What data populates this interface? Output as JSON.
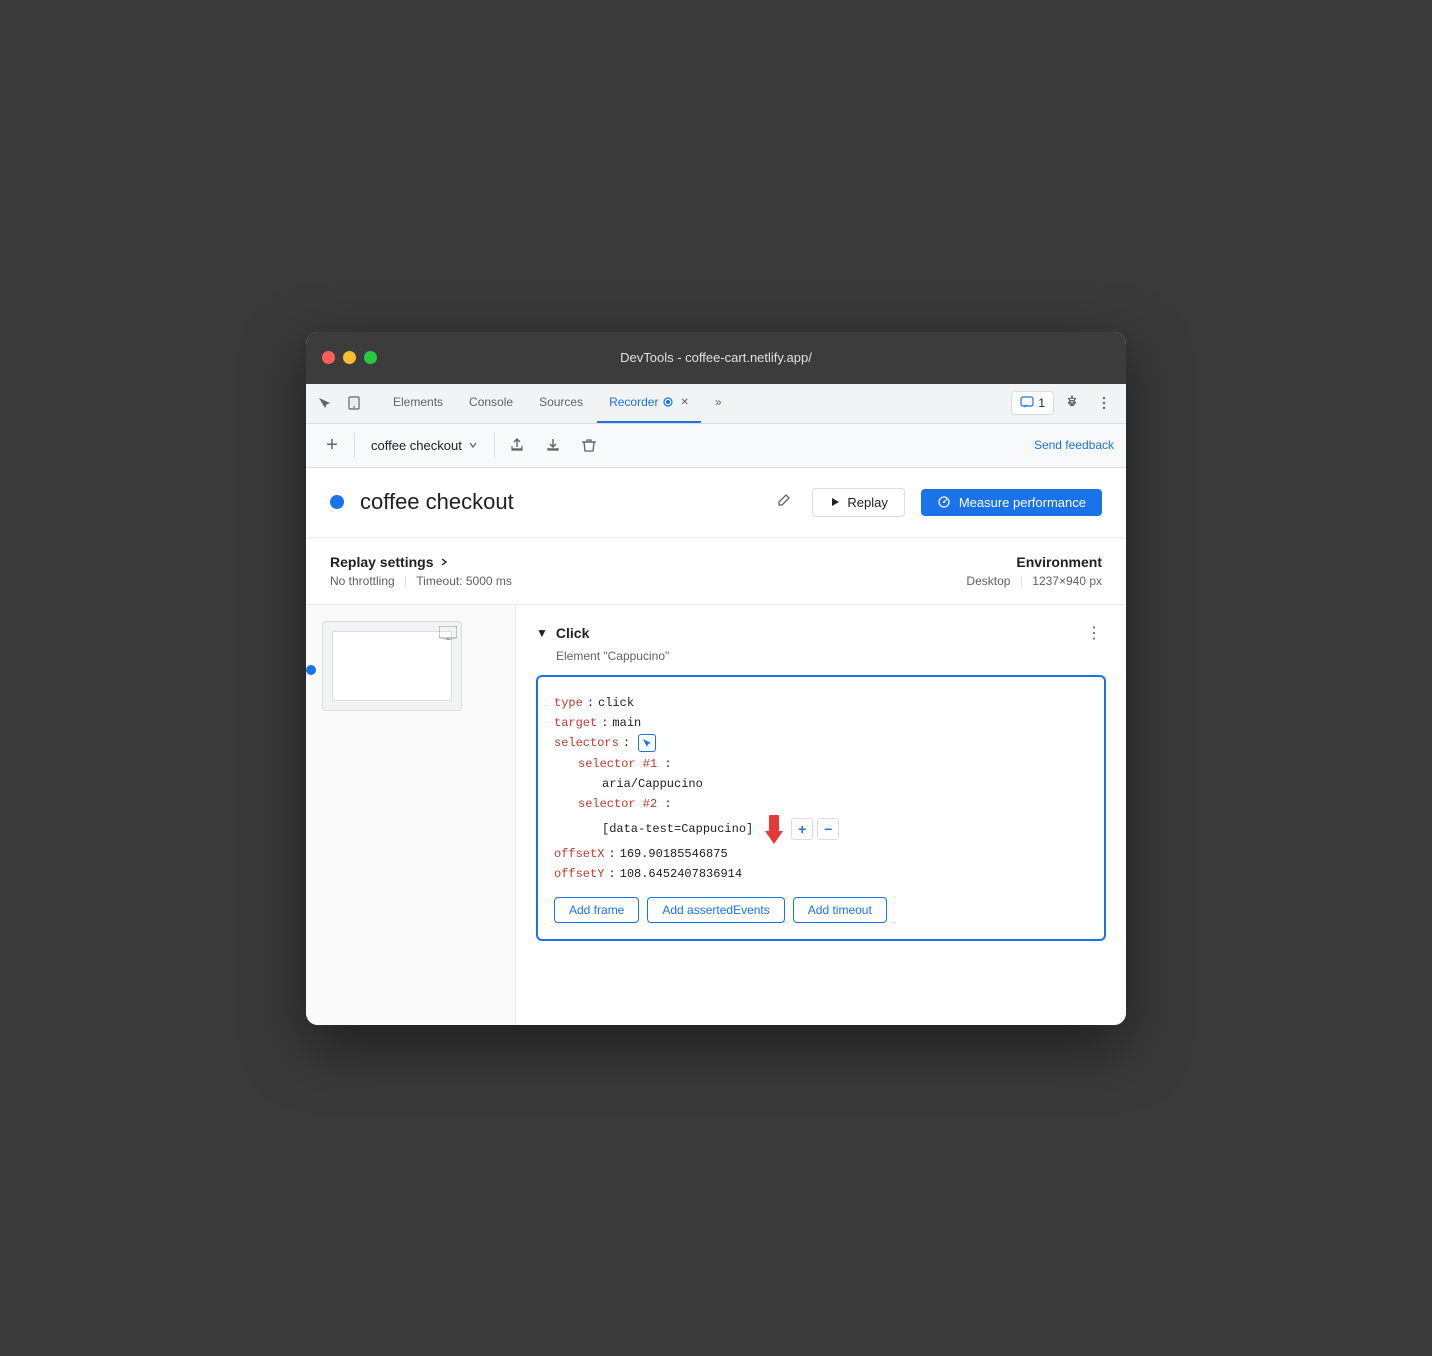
{
  "window": {
    "title": "DevTools - coffee-cart.netlify.app/"
  },
  "titlebar": {
    "title": "DevTools - coffee-cart.netlify.app/"
  },
  "devtools_tabs": {
    "tabs": [
      {
        "label": "Elements",
        "active": false
      },
      {
        "label": "Console",
        "active": false
      },
      {
        "label": "Sources",
        "active": false
      },
      {
        "label": "Recorder",
        "active": true
      },
      {
        "label": "»",
        "active": false
      }
    ],
    "badge_count": "1"
  },
  "toolbar": {
    "add_label": "+",
    "recording_name": "coffee checkout",
    "send_feedback": "Send feedback"
  },
  "header": {
    "title": "coffee checkout",
    "replay_label": "Replay",
    "measure_label": "Measure performance"
  },
  "replay_settings": {
    "title": "Replay settings",
    "throttling": "No throttling",
    "timeout": "Timeout: 5000 ms",
    "env_title": "Environment",
    "env_type": "Desktop",
    "env_size": "1237×940 px"
  },
  "step": {
    "type": "Click",
    "element": "Element \"Cappucino\"",
    "code": {
      "type_key": "type",
      "type_val": "click",
      "target_key": "target",
      "target_val": "main",
      "selectors_key": "selectors",
      "selector1_key": "selector #1",
      "selector1_val": "aria/Cappucino",
      "selector2_key": "selector #2",
      "selector2_val": "[data-test=Cappucino]",
      "offsetX_key": "offsetX",
      "offsetX_val": "169.90185546875",
      "offsetY_key": "offsetY",
      "offsetY_val": "108.6452407836914"
    }
  },
  "action_buttons": {
    "add_frame": "Add frame",
    "add_asserted": "Add assertedEvents",
    "add_timeout": "Add timeout"
  }
}
